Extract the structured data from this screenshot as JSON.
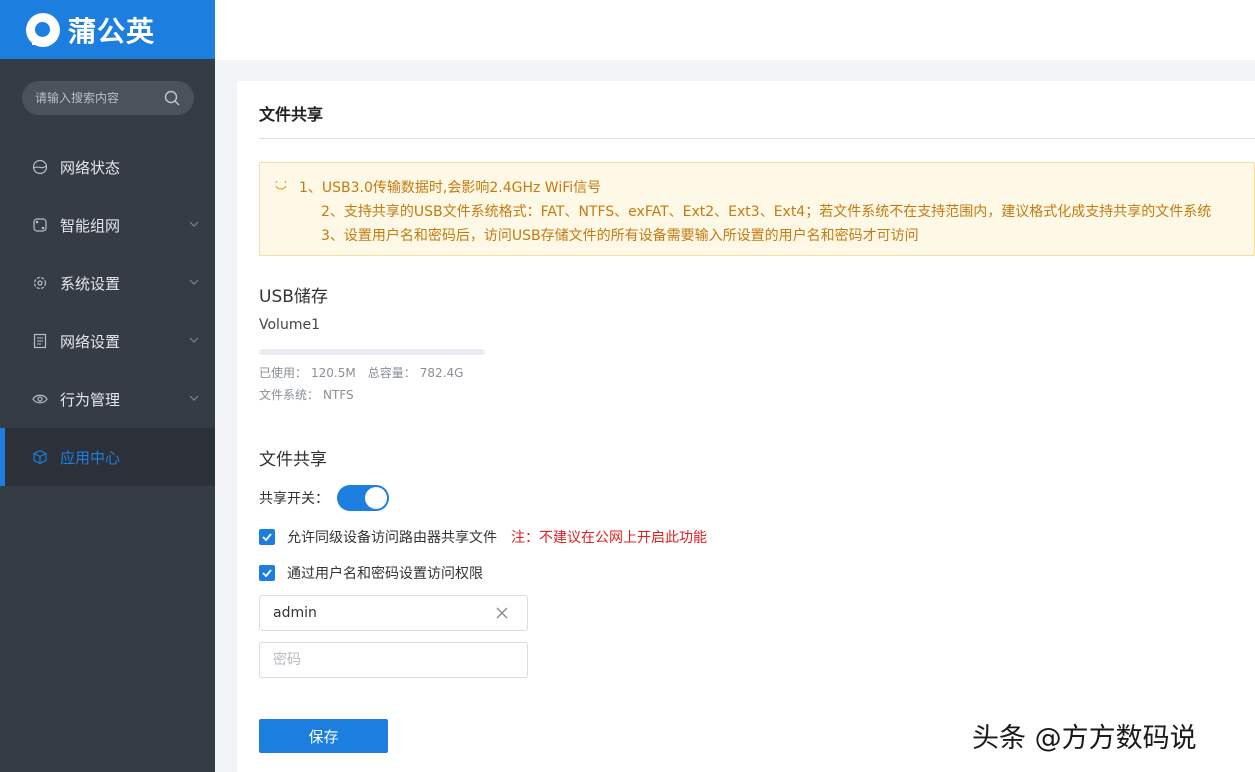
{
  "brand": {
    "name": "蒲公英",
    "color": "#1c7fe0"
  },
  "search": {
    "placeholder": "请输入搜索内容",
    "icon": "search-icon"
  },
  "sidebar": {
    "items": [
      {
        "label": "网络状态",
        "icon": "globe-icon",
        "has_submenu": false,
        "active": false
      },
      {
        "label": "智能组网",
        "icon": "network-icon",
        "has_submenu": true,
        "active": false
      },
      {
        "label": "系统设置",
        "icon": "gear-icon",
        "has_submenu": true,
        "active": false
      },
      {
        "label": "网络设置",
        "icon": "document-icon",
        "has_submenu": true,
        "active": false
      },
      {
        "label": "行为管理",
        "icon": "eye-icon",
        "has_submenu": true,
        "active": false
      },
      {
        "label": "应用中心",
        "icon": "cube-icon",
        "has_submenu": false,
        "active": true
      }
    ]
  },
  "page": {
    "title": "文件共享",
    "notice": {
      "lines": [
        "1、USB3.0传输数据时,会影响2.4GHz WiFi信号",
        "2、支持共享的USB文件系统格式：FAT、NTFS、exFAT、Ext2、Ext3、Ext4；若文件系统不在支持范围内，建议格式化成支持共享的文件系统",
        "3、设置用户名和密码后，访问USB存储文件的所有设备需要输入所设置的用户名和密码才可访问"
      ]
    },
    "usb": {
      "heading": "USB储存",
      "volume_name": "Volume1",
      "usage_fraction": 0.00015,
      "used_label": "已使用：",
      "used_value": "120.5M",
      "total_label": "总容量：",
      "total_value": "782.4G",
      "fs_label": "文件系统：",
      "fs_value": "NTFS"
    },
    "sharing": {
      "heading": "文件共享",
      "switch_label": "共享开关：",
      "switch_on": true,
      "allow_lan_label": "允许同级设备访问路由器共享文件",
      "allow_lan_checked": true,
      "warning": "注：不建议在公网上开启此功能",
      "auth_label": "通过用户名和密码设置访问权限",
      "auth_checked": true,
      "username_value": "admin",
      "password_placeholder": "密码"
    },
    "save_label": "保存"
  },
  "watermark": "头条 @方方数码说"
}
